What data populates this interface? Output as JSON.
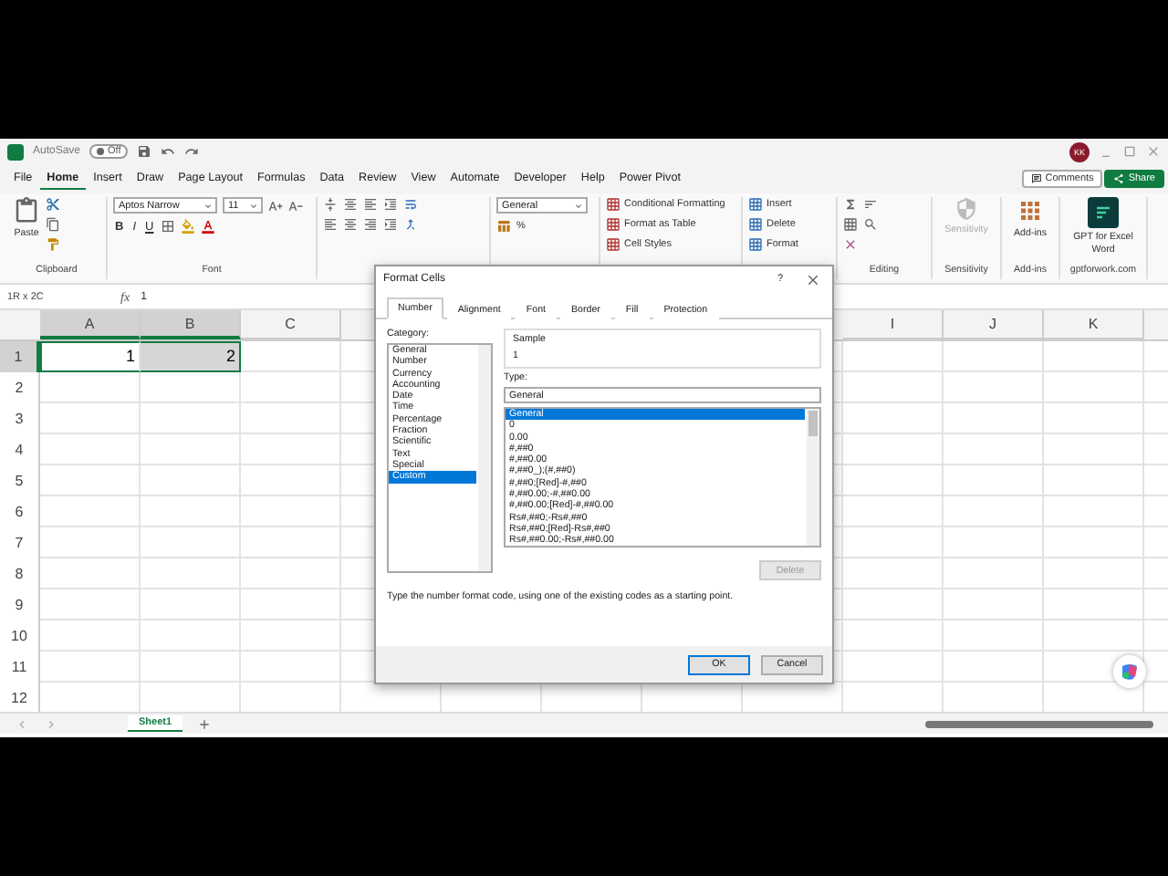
{
  "title_bar": {
    "autosave_label": "AutoSave",
    "autosave": {
      "label": "Off",
      "on": false
    },
    "avatar": "KK"
  },
  "menu": [
    {
      "label": "File",
      "selected": false
    },
    {
      "label": "Home",
      "selected": true
    },
    {
      "label": "Insert",
      "selected": false
    },
    {
      "label": "Draw",
      "selected": false
    },
    {
      "label": "Page Layout",
      "selected": false
    },
    {
      "label": "Formulas",
      "selected": false
    },
    {
      "label": "Data",
      "selected": false
    },
    {
      "label": "Review",
      "selected": false
    },
    {
      "label": "View",
      "selected": false
    },
    {
      "label": "Automate",
      "selected": false
    },
    {
      "label": "Developer",
      "selected": false
    },
    {
      "label": "Help",
      "selected": false
    },
    {
      "label": "Power Pivot",
      "selected": false
    }
  ],
  "comments_button": "Comments",
  "share_button": "Share",
  "ribbon": [
    {
      "kind": "clipboard",
      "label": "Clipboard",
      "paste": "Paste"
    },
    {
      "kind": "font",
      "label": "Font",
      "font_name": "Aptos Narrow",
      "font_size": "11",
      "bold": "B",
      "italic": "I",
      "underline": "U"
    },
    {
      "kind": "alignment"
    },
    {
      "kind": "number",
      "format": "General",
      "percent": "%"
    },
    {
      "kind": "styles",
      "items": [
        "Conditional Formatting",
        "Format as Table",
        "Cell Styles"
      ]
    },
    {
      "kind": "cells",
      "items": [
        "Insert",
        "Delete",
        "Format"
      ]
    },
    {
      "kind": "editing",
      "label": "Editing"
    },
    {
      "kind": "sensitivity",
      "label": "Sensitivity",
      "button": "Sensitivity",
      "disabled": true
    },
    {
      "kind": "addins",
      "label": "Add-ins",
      "button": "Add-ins"
    },
    {
      "kind": "gpt",
      "label": "gptforwork.com",
      "button": "GPT for Excel Word"
    }
  ],
  "formula_bar": {
    "name_box": "1R x 2C",
    "fx": "fx",
    "value": "1"
  },
  "sheet": {
    "columns_left": [
      {
        "label": "A",
        "selected": true
      },
      {
        "label": "B",
        "selected": true
      },
      {
        "label": "C",
        "selected": false
      }
    ],
    "columns_right": [
      {
        "label": "I",
        "selected": false
      },
      {
        "label": "J",
        "selected": false
      },
      {
        "label": "K",
        "selected": false
      }
    ],
    "rows": [
      {
        "header": "1",
        "selected": true,
        "cells": [
          {
            "value": "1",
            "selected": true,
            "active": true
          },
          {
            "value": "2",
            "selected": true,
            "active": false
          }
        ]
      },
      {
        "header": "2",
        "selected": false
      },
      {
        "header": "3",
        "selected": false
      },
      {
        "header": "4",
        "selected": false
      },
      {
        "header": "5",
        "selected": false
      },
      {
        "header": "6",
        "selected": false
      },
      {
        "header": "7",
        "selected": false
      },
      {
        "header": "8",
        "selected": false
      },
      {
        "header": "9",
        "selected": false
      },
      {
        "header": "10",
        "selected": false
      },
      {
        "header": "11",
        "selected": false
      },
      {
        "header": "12",
        "selected": false
      }
    ]
  },
  "sheet_tabs": [
    {
      "label": "Sheet1",
      "selected": true
    }
  ],
  "dialog": {
    "title": "Format Cells",
    "help": "?",
    "tabs": [
      {
        "label": "Number",
        "selected": true
      },
      {
        "label": "Alignment",
        "selected": false
      },
      {
        "label": "Font",
        "selected": false
      },
      {
        "label": "Border",
        "selected": false
      },
      {
        "label": "Fill",
        "selected": false
      },
      {
        "label": "Protection",
        "selected": false
      }
    ],
    "category_label": "Category:",
    "categories": [
      {
        "label": "General",
        "selected": false
      },
      {
        "label": "Number",
        "selected": false
      },
      {
        "label": "Currency",
        "selected": false
      },
      {
        "label": "Accounting",
        "selected": false
      },
      {
        "label": "Date",
        "selected": false
      },
      {
        "label": "Time",
        "selected": false
      },
      {
        "label": "Percentage",
        "selected": false
      },
      {
        "label": "Fraction",
        "selected": false
      },
      {
        "label": "Scientific",
        "selected": false
      },
      {
        "label": "Text",
        "selected": false
      },
      {
        "label": "Special",
        "selected": false
      },
      {
        "label": "Custom",
        "selected": true
      }
    ],
    "sample_label": "Sample",
    "sample_value": "1",
    "type_label": "Type:",
    "type_value": "General",
    "formats": [
      {
        "label": "General",
        "selected": true
      },
      {
        "label": "0",
        "selected": false
      },
      {
        "label": "0.00",
        "selected": false
      },
      {
        "label": "#,##0",
        "selected": false
      },
      {
        "label": "#,##0.00",
        "selected": false
      },
      {
        "label": "#,##0_);(#,##0)",
        "selected": false
      },
      {
        "label": "#,##0;[Red]-#,##0",
        "selected": false
      },
      {
        "label": "#,##0.00;-#,##0.00",
        "selected": false
      },
      {
        "label": "#,##0.00;[Red]-#,##0.00",
        "selected": false
      },
      {
        "label": "Rs#,##0;-Rs#,##0",
        "selected": false
      },
      {
        "label": "Rs#,##0;[Red]-Rs#,##0",
        "selected": false
      },
      {
        "label": "Rs#,##0.00;-Rs#,##0.00",
        "selected": false
      }
    ],
    "delete_button": {
      "label": "Delete",
      "disabled": true
    },
    "description": "Type the number format code, using one of the existing codes as a starting point.",
    "ok_button": "OK",
    "cancel_button": "Cancel"
  }
}
